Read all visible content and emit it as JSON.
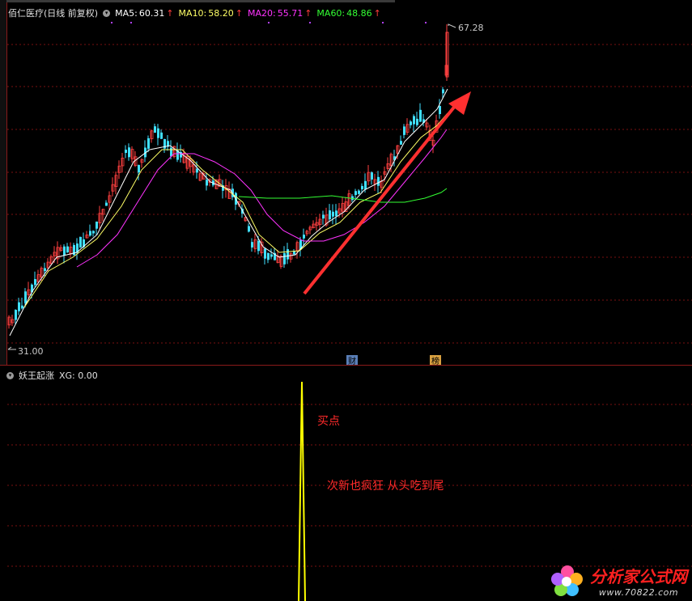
{
  "main": {
    "stock_title": "佰仁医疗(日线 前复权)",
    "ma5": {
      "label": "MA5:",
      "value": "60.31",
      "color": "#ffffff"
    },
    "ma10": {
      "label": "MA10:",
      "value": "58.20",
      "color": "#ffff66"
    },
    "ma20": {
      "label": "MA20:",
      "value": "55.71",
      "color": "#ff33ff"
    },
    "ma60": {
      "label": "MA60:",
      "value": "48.86",
      "color": "#33ff33"
    },
    "high_label": "67.28",
    "low_label": "31.00",
    "badge_cai": "财",
    "badge_bang": "榜"
  },
  "sub": {
    "indicator_title": "妖王起涨",
    "xg_label": "XG: 0.00",
    "annotation_buy": "买点",
    "annotation_note": "次新也疯狂 从头吃到尾"
  },
  "watermark": {
    "title": "分析家公式网",
    "url": "www.70822.com"
  },
  "colors": {
    "up_candle": "#ff4040",
    "down_candle": "#40e0ff",
    "grid": "#7a1010",
    "arrow": "#ff3030",
    "signal": "#ffff00"
  }
}
